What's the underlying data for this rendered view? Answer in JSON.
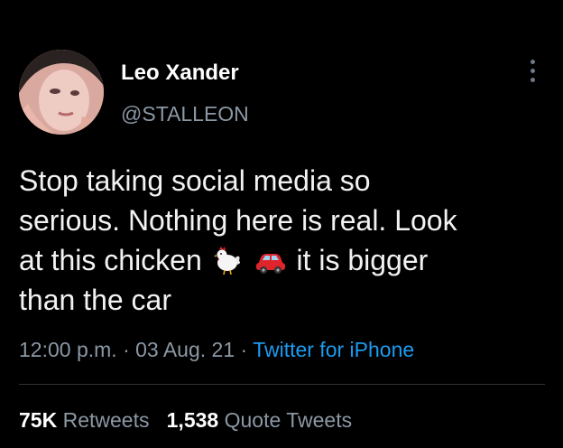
{
  "author": {
    "name": "Leo Xander",
    "handle": "@STALLEON"
  },
  "tweet": {
    "lines": [
      "Stop taking social media so",
      "serious. Nothing here is real. Look",
      "at this chicken",
      "it is bigger",
      "than the car"
    ],
    "emojis": [
      "chicken-emoji",
      "car-emoji"
    ]
  },
  "meta": {
    "time": "12:00 p.m.",
    "sep1": "·",
    "date": "03 Aug. 21",
    "sep2": "·",
    "source": "Twitter for iPhone"
  },
  "stats": {
    "retweets_count": "75K",
    "retweets_label": "Retweets",
    "quotes_count": "1,538",
    "quotes_label": "Quote Tweets"
  },
  "colors": {
    "background": "#000000",
    "text": "#f2f2f2",
    "secondary": "#8b98a5",
    "link": "#1d9bf0"
  }
}
